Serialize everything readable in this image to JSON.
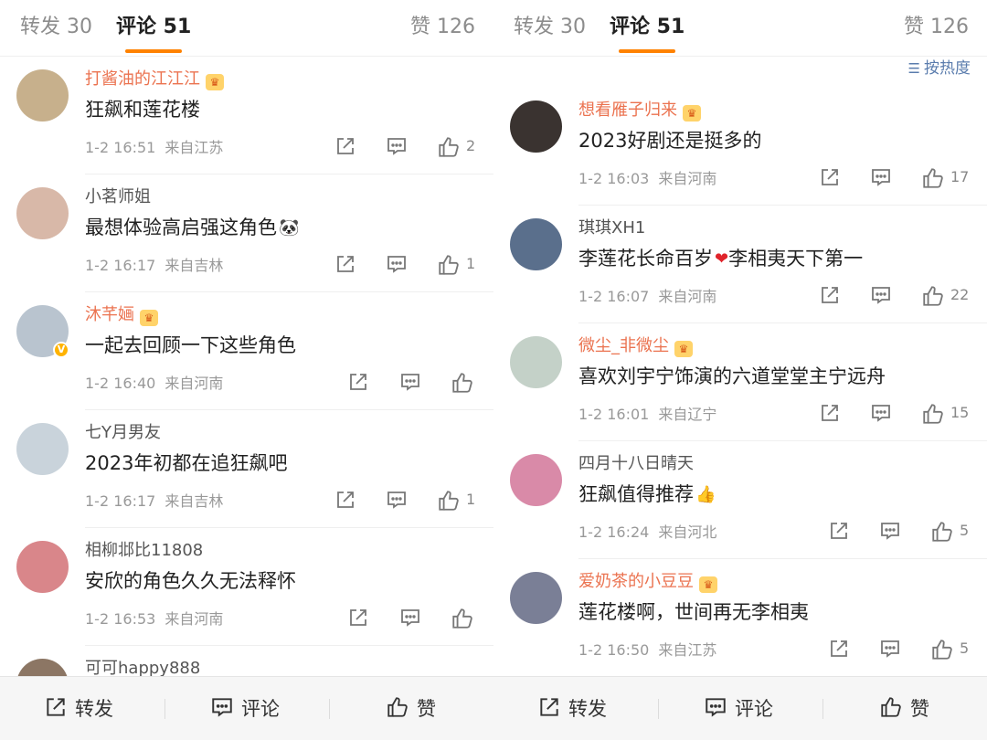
{
  "panels": [
    {
      "tabs": {
        "repost": "转发 30",
        "comment": "评论 51",
        "likes": "赞 126"
      },
      "sort_label": "",
      "comments": [
        {
          "user": "打酱油的江江江",
          "vip": true,
          "text": "狂飙和莲花楼",
          "emoji": "",
          "time": "1-2 16:51",
          "location": "来自江苏",
          "likes": "2",
          "avatar_color": "#c7b08c"
        },
        {
          "user": "小茗师姐",
          "vip": false,
          "text": "最想体验高启强这角色",
          "emoji": "🐼",
          "time": "1-2 16:17",
          "location": "来自吉林",
          "likes": "1",
          "avatar_color": "#d8b8a8"
        },
        {
          "user": "沐芊婳",
          "vip": true,
          "text": "一起去回顾一下这些角色",
          "emoji": "",
          "time": "1-2 16:40",
          "location": "来自河南",
          "likes": "",
          "avatar_color": "#b9c4cf"
        },
        {
          "user": "七Y月男友",
          "vip": false,
          "text": "2023年初都在追狂飙吧",
          "emoji": "",
          "time": "1-2 16:17",
          "location": "来自吉林",
          "likes": "1",
          "avatar_color": "#c9d3db"
        },
        {
          "user": "相柳邶比11808",
          "vip": false,
          "text": "安欣的角色久久无法释怀",
          "emoji": "",
          "time": "1-2 16:53",
          "location": "来自河南",
          "likes": "",
          "avatar_color": "#d9868a"
        },
        {
          "user": "可可happy888",
          "vip": false,
          "text": "",
          "emoji": "",
          "time": "",
          "location": "",
          "likes": "",
          "avatar_color": "#8c7664"
        }
      ]
    },
    {
      "tabs": {
        "repost": "转发 30",
        "comment": "评论 51",
        "likes": "赞 126"
      },
      "sort_label": "按热度",
      "comments": [
        {
          "user": "想看雁子归来",
          "vip": true,
          "text": "2023好剧还是挺多的",
          "emoji": "",
          "time": "1-2 16:03",
          "location": "来自河南",
          "likes": "17",
          "avatar_color": "#3a3330"
        },
        {
          "user": "琪琪XH1",
          "vip": false,
          "text": "李莲花长命百岁",
          "emoji": "❤",
          "text2": "李相夷天下第一",
          "time": "1-2 16:07",
          "location": "来自河南",
          "likes": "22",
          "avatar_color": "#5a6f8c"
        },
        {
          "user": "微尘_非微尘",
          "vip": true,
          "text": "喜欢刘宇宁饰演的六道堂堂主宁远舟",
          "emoji": "",
          "time": "1-2 16:01",
          "location": "来自辽宁",
          "likes": "15",
          "avatar_color": "#c4d1c8"
        },
        {
          "user": "四月十八日晴天",
          "vip": false,
          "text": "狂飙值得推荐",
          "emoji": "👍",
          "time": "1-2 16:24",
          "location": "来自河北",
          "likes": "5",
          "avatar_color": "#d98aa8"
        },
        {
          "user": "爱奶茶的小豆豆",
          "vip": true,
          "text": "莲花楼啊，世间再无李相夷",
          "emoji": "",
          "time": "1-2 16:50",
          "location": "来自江苏",
          "likes": "5",
          "avatar_color": "#7a7f96"
        }
      ]
    }
  ],
  "bottom_bar": {
    "repost": "转发",
    "comment": "评论",
    "like": "赞"
  },
  "colors": {
    "accent": "#ff8200",
    "vip_name": "#eb7350",
    "link_blue": "#5a7cad"
  }
}
